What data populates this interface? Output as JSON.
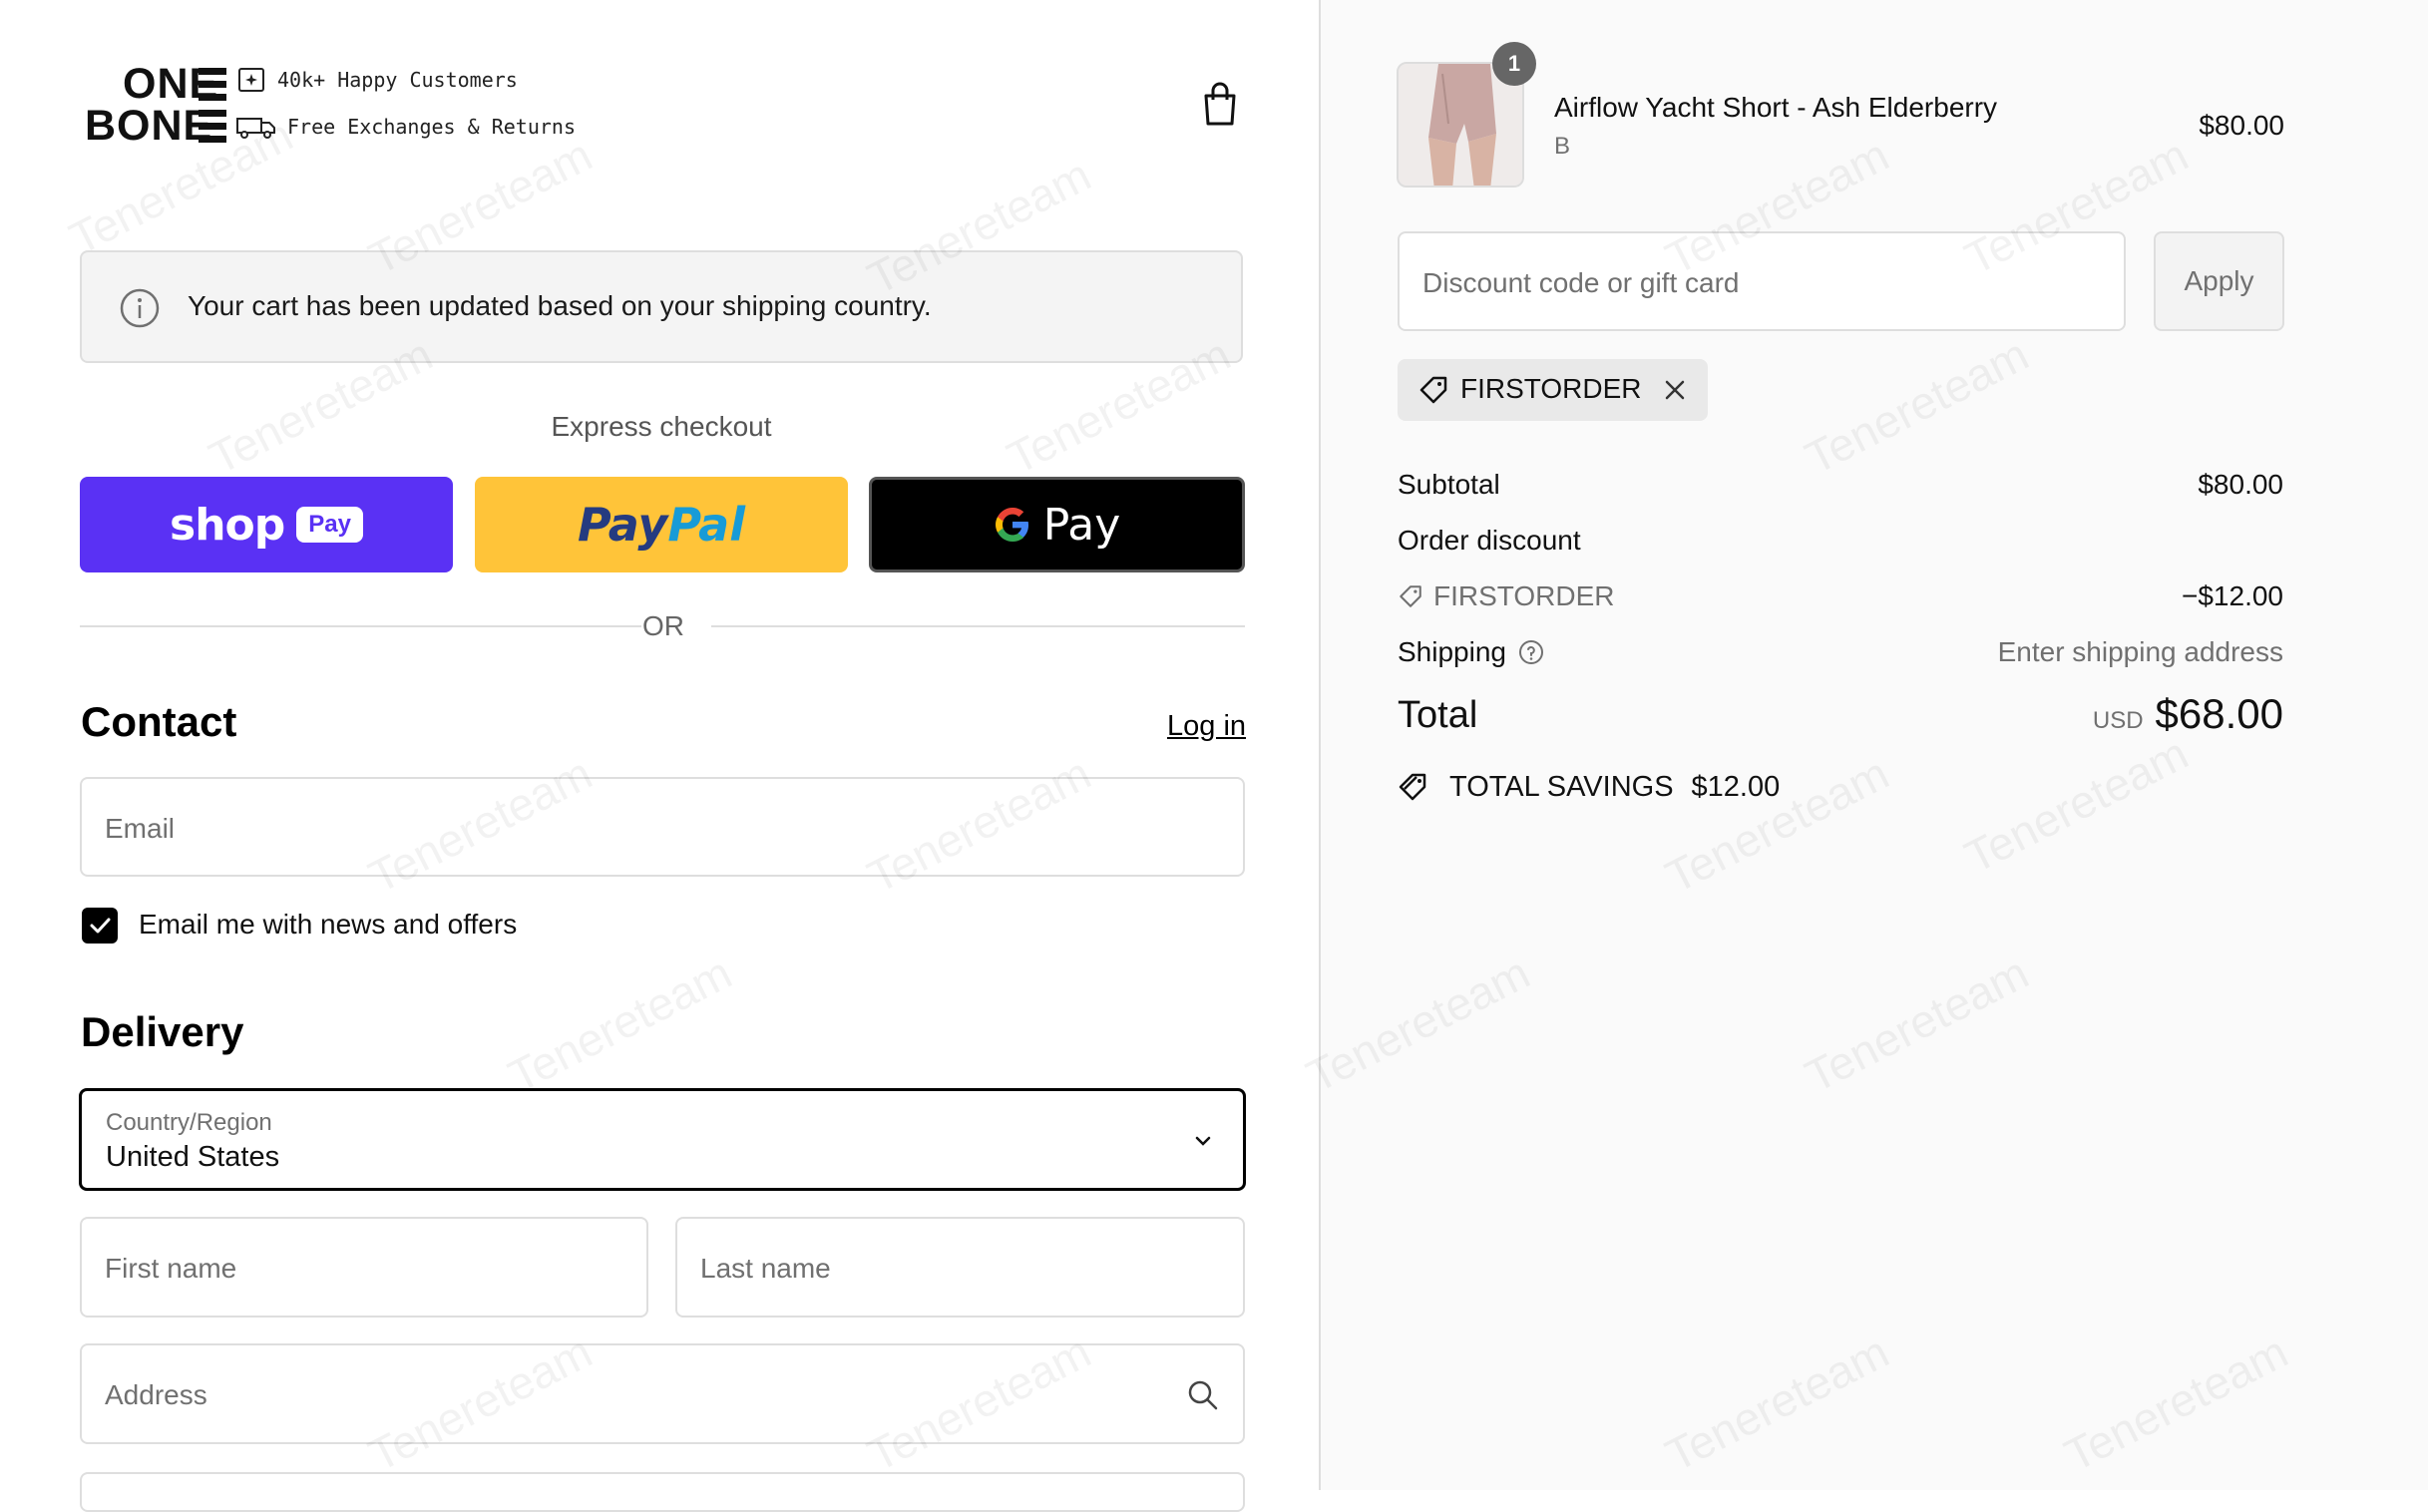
{
  "brand": {
    "logo_line1": "ONE",
    "logo_line2": "BONE"
  },
  "header": {
    "tagline_1": "40k+ Happy Customers",
    "tagline_2": "Free Exchanges & Returns",
    "cart_icon": "shopping-bag-icon"
  },
  "notice": {
    "text": "Your cart has been updated based on your shipping country.",
    "icon": "info-icon"
  },
  "express": {
    "label": "Express checkout",
    "shop_pay_word": "shop",
    "shop_pay_pill": "Pay",
    "paypal_1": "Pay",
    "paypal_2": "Pal",
    "gpay_g": "G",
    "gpay_pay": "Pay",
    "or": "OR"
  },
  "contact": {
    "title": "Contact",
    "login": "Log in",
    "email_placeholder": "Email",
    "newsletter_label": "Email me with news and offers",
    "newsletter_checked": true
  },
  "delivery": {
    "title": "Delivery",
    "country_label": "Country/Region",
    "country_value": "United States",
    "first_name_placeholder": "First name",
    "last_name_placeholder": "Last name",
    "address_placeholder": "Address"
  },
  "summary": {
    "product": {
      "name": "Airflow Yacht Short - Ash Elderberry",
      "variant": "B",
      "price": "$80.00",
      "quantity": "1"
    },
    "discount_placeholder": "Discount code or gift card",
    "apply_label": "Apply",
    "applied_code": "FIRSTORDER",
    "subtotal_label": "Subtotal",
    "subtotal_value": "$80.00",
    "order_discount_label": "Order discount",
    "discount_code_line": "FIRSTORDER",
    "discount_value": "−$12.00",
    "shipping_label": "Shipping",
    "shipping_value": "Enter shipping address",
    "total_label": "Total",
    "currency": "USD",
    "total_value": "$68.00",
    "savings_label": "TOTAL SAVINGS",
    "savings_value": "$12.00"
  },
  "watermark": "Tenereteam",
  "colors": {
    "shop_pay": "#5a31f4",
    "paypal": "#ffc439",
    "gpay": "#000000",
    "summary_bg": "#fafafa"
  }
}
